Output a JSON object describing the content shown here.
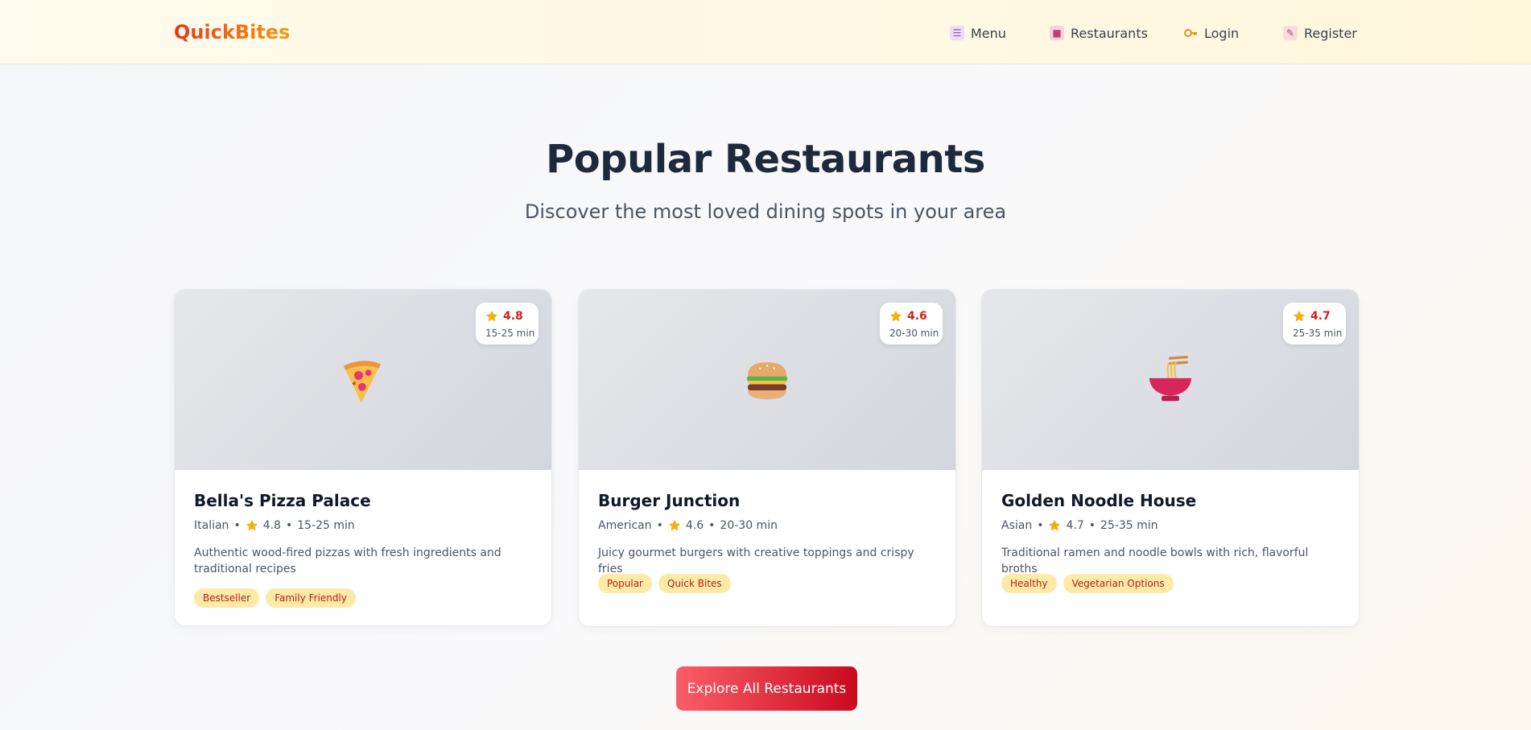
{
  "brand": "QuickBites",
  "nav": {
    "menu": "Menu",
    "restaurants": "Restaurants",
    "login": "Login",
    "register": "Register"
  },
  "nav_icons": [
    "menu-book-icon",
    "storefront-icon",
    "key-icon",
    "memo-icon"
  ],
  "hero": {
    "title": "Popular Restaurants",
    "subtitle": "Discover the most loved dining spots in your area"
  },
  "restaurants": [
    {
      "name": "Bella's Pizza Palace",
      "rating": "4.8",
      "time": "15-25 min",
      "cuisine": "Italian",
      "meta_rating": "4.8",
      "meta_time": "15-25 min",
      "description": "Authentic wood-fired pizzas with fresh ingredients and traditional recipes",
      "tags": [
        "Bestseller",
        "Family Friendly"
      ],
      "icon": "pizza-icon"
    },
    {
      "name": "Burger Junction",
      "rating": "4.6",
      "time": "20-30 min",
      "cuisine": "American",
      "meta_rating": "4.6",
      "meta_time": "20-30 min",
      "description": "Juicy gourmet burgers with creative toppings and crispy fries",
      "tags": [
        "Popular",
        "Quick Bites"
      ],
      "icon": "burger-icon"
    },
    {
      "name": "Golden Noodle House",
      "rating": "4.7",
      "time": "25-35 min",
      "cuisine": "Asian",
      "meta_rating": "4.7",
      "meta_time": "25-35 min",
      "description": "Traditional ramen and noodle bowls with rich, flavorful broths",
      "tags": [
        "Healthy",
        "Vegetarian Options"
      ],
      "icon": "noodle-bowl-icon"
    }
  ],
  "separator": "•",
  "cta": "Explore All Restaurants",
  "colors": {
    "accent_red": "#d0201c",
    "tag_bg": "#fdeaa6",
    "cta_start": "#fb5e68",
    "cta_end": "#c90a1f",
    "star": "#f5b301"
  }
}
